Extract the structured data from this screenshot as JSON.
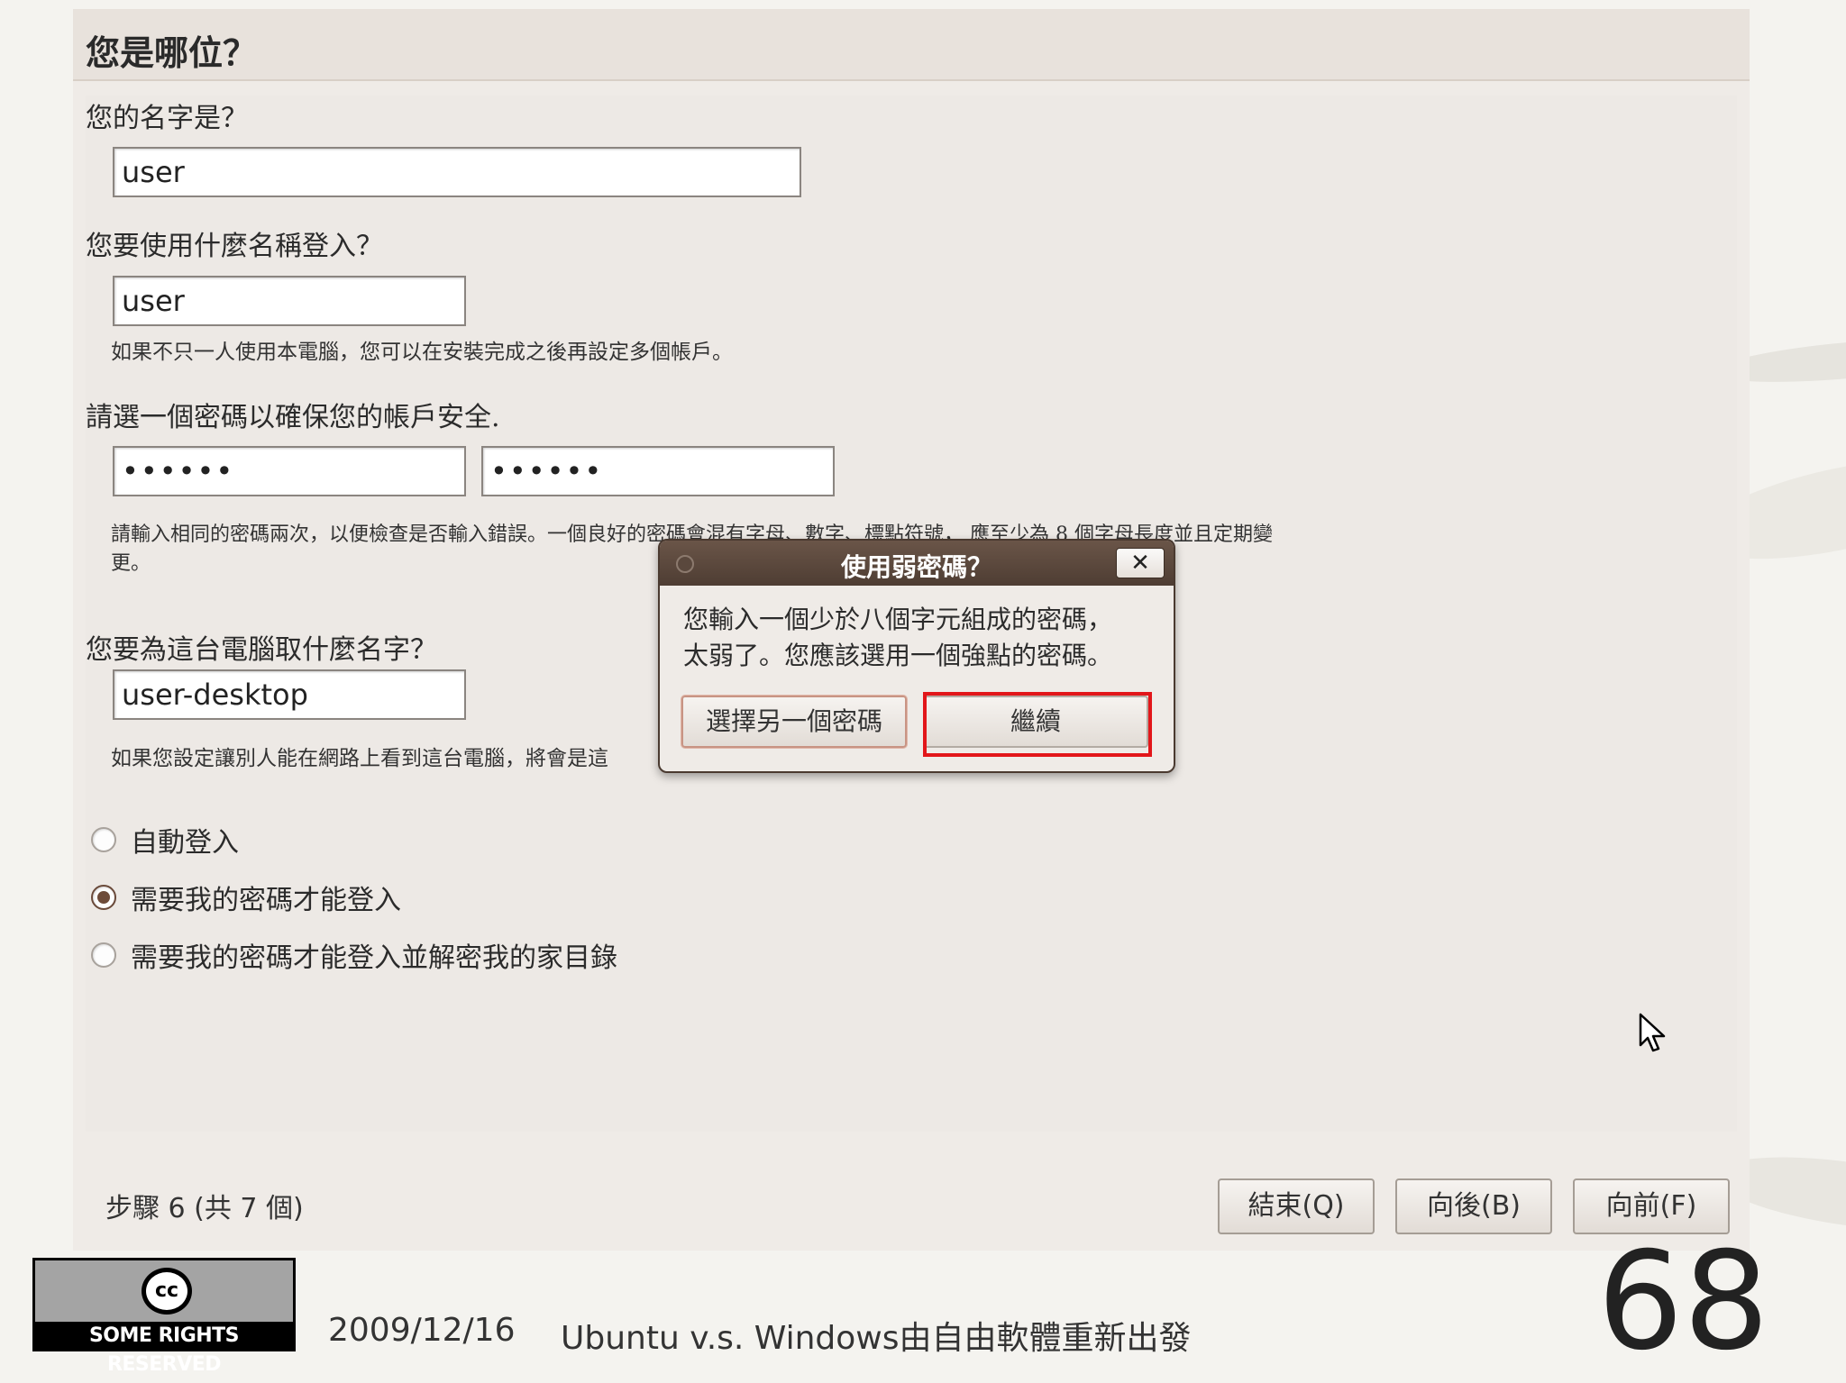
{
  "installer": {
    "title": "您是哪位？",
    "name_question": "您的名字是？",
    "name_value": "user",
    "login_question": "您要使用什麼名稱登入？",
    "login_value": "user",
    "login_hint": "如果不只一人使用本電腦，您可以在安裝完成之後再設定多個帳戶。",
    "password_question": "請選一個密碼以確保您的帳戶安全.",
    "password_value": "••••••",
    "password_confirm_value": "••••••",
    "password_hint_line1": "請輸入相同的密碼兩次，以便檢查是否輸入錯誤。一個良好的密碼會混有字母、數字、標點符號， 應至少為 8 個字母長度並且定期變",
    "password_hint_line2": "更。",
    "computer_question": "您要為這台電腦取什麼名字？",
    "computer_value": "user-desktop",
    "computer_hint": "如果您設定讓別人能在網路上看到這台電腦，將會是這",
    "radio_options": [
      {
        "label": "自動登入",
        "checked": false
      },
      {
        "label": "需要我的密碼才能登入",
        "checked": true
      },
      {
        "label": "需要我的密碼才能登入並解密我的家目錄",
        "checked": false
      }
    ],
    "step_label": "步驟 6 (共 7 個)",
    "quit_button": "結束(Q)",
    "back_button": "向後(B)",
    "forward_button": "向前(F)"
  },
  "dialog": {
    "title": "使用弱密碼？",
    "close_label": "✕",
    "message_line1": "您輸入一個少於八個字元組成的密碼，",
    "message_line2": "太弱了。您應該選用一個強點的密碼。",
    "choose_another_button": "選擇另一個密碼",
    "continue_button": "繼續"
  },
  "slide_footer": {
    "cc_symbol": "cc",
    "cc_text": "SOME RIGHTS RESERVED",
    "date": "2009/12/16",
    "title": "Ubuntu v.s. Windows由自由軟體重新出發",
    "page_number": "68"
  },
  "colors": {
    "dialog_titlebar": "#4e3d33",
    "highlight_box": "#e2161a",
    "radio_checked": "#6d4b39"
  }
}
